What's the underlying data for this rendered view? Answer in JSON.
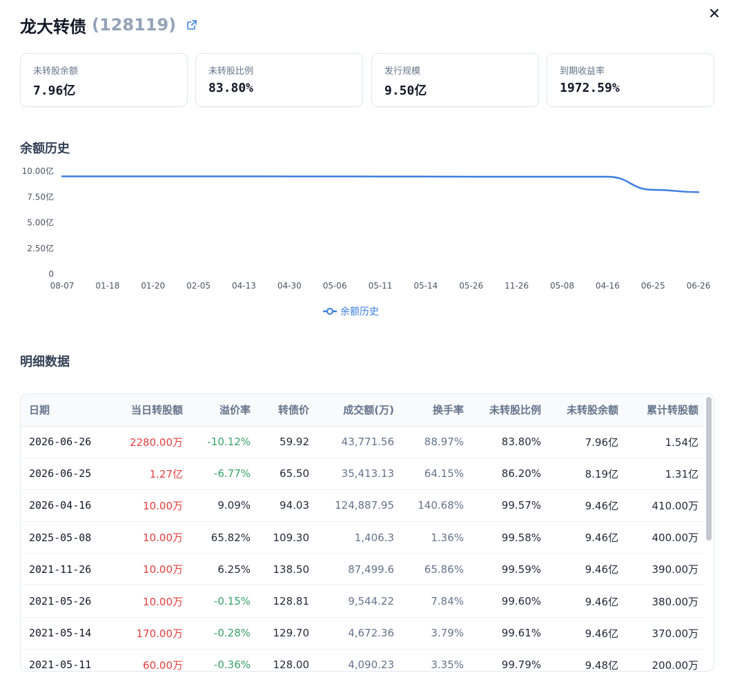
{
  "header": {
    "name": "龙大转债",
    "code": "(128119)"
  },
  "stats": [
    {
      "label": "未转股余额",
      "value": "7.96亿"
    },
    {
      "label": "未转股比例",
      "value": "83.80%"
    },
    {
      "label": "发行规模",
      "value": "9.50亿"
    },
    {
      "label": "到期收益率",
      "value": "1972.59%"
    }
  ],
  "sections": {
    "history_title": "余额历史",
    "detail_title": "明细数据"
  },
  "chart_data": {
    "type": "line",
    "title": "",
    "xlabel": "",
    "ylabel": "",
    "categories": [
      "08-07",
      "01-18",
      "01-20",
      "02-05",
      "04-13",
      "04-30",
      "05-06",
      "05-11",
      "05-14",
      "05-26",
      "11-26",
      "05-08",
      "04-16",
      "06-25",
      "06-26"
    ],
    "series": [
      {
        "name": "余额历史",
        "values": [
          9.5,
          9.5,
          9.5,
          9.5,
          9.5,
          9.49,
          9.49,
          9.48,
          9.48,
          9.46,
          9.46,
          9.46,
          9.46,
          8.19,
          7.96
        ],
        "color": "#3b7de0"
      }
    ],
    "yticks": [
      "0",
      "2.50亿",
      "5.00亿",
      "7.50亿",
      "10.00亿"
    ],
    "ylim": [
      0,
      10
    ],
    "grid": false,
    "legend": "bottom-center"
  },
  "table": {
    "columns": [
      "日期",
      "当日转股额",
      "溢价率",
      "转债价",
      "成交额(万)",
      "换手率",
      "未转股比例",
      "未转股余额",
      "累计转股额"
    ],
    "rows": [
      {
        "date": "2026-06-26",
        "conv": "2280.00万",
        "premium": "-10.12%",
        "price": "59.92",
        "turnover": "43,771.56",
        "rate": "88.97%",
        "ratio": "83.80%",
        "balance": "7.96亿",
        "cum": "1.54亿"
      },
      {
        "date": "2026-06-25",
        "conv": "1.27亿",
        "premium": "-6.77%",
        "price": "65.50",
        "turnover": "35,413.13",
        "rate": "64.15%",
        "ratio": "86.20%",
        "balance": "8.19亿",
        "cum": "1.31亿"
      },
      {
        "date": "2026-04-16",
        "conv": "10.00万",
        "premium": "9.09%",
        "price": "94.03",
        "turnover": "124,887.95",
        "rate": "140.68%",
        "ratio": "99.57%",
        "balance": "9.46亿",
        "cum": "410.00万"
      },
      {
        "date": "2025-05-08",
        "conv": "10.00万",
        "premium": "65.82%",
        "price": "109.30",
        "turnover": "1,406.3",
        "rate": "1.36%",
        "ratio": "99.58%",
        "balance": "9.46亿",
        "cum": "400.00万"
      },
      {
        "date": "2021-11-26",
        "conv": "10.00万",
        "premium": "6.25%",
        "price": "138.50",
        "turnover": "87,499.6",
        "rate": "65.86%",
        "ratio": "99.59%",
        "balance": "9.46亿",
        "cum": "390.00万"
      },
      {
        "date": "2021-05-26",
        "conv": "10.00万",
        "premium": "-0.15%",
        "price": "128.81",
        "turnover": "9,544.22",
        "rate": "7.84%",
        "ratio": "99.60%",
        "balance": "9.46亿",
        "cum": "380.00万"
      },
      {
        "date": "2021-05-14",
        "conv": "170.00万",
        "premium": "-0.28%",
        "price": "129.70",
        "turnover": "4,672.36",
        "rate": "3.79%",
        "ratio": "99.61%",
        "balance": "9.46亿",
        "cum": "370.00万"
      },
      {
        "date": "2021-05-11",
        "conv": "60.00万",
        "premium": "-0.36%",
        "price": "128.00",
        "turnover": "4,090.23",
        "rate": "3.35%",
        "ratio": "99.79%",
        "balance": "9.48亿",
        "cum": "200.00万"
      }
    ]
  },
  "colors": {
    "line": "#3b7de0",
    "negative_premium": "#38a169",
    "conversion": "#e53e3e"
  },
  "icons": {
    "external_link": "external-link-icon",
    "close": "close-icon"
  }
}
